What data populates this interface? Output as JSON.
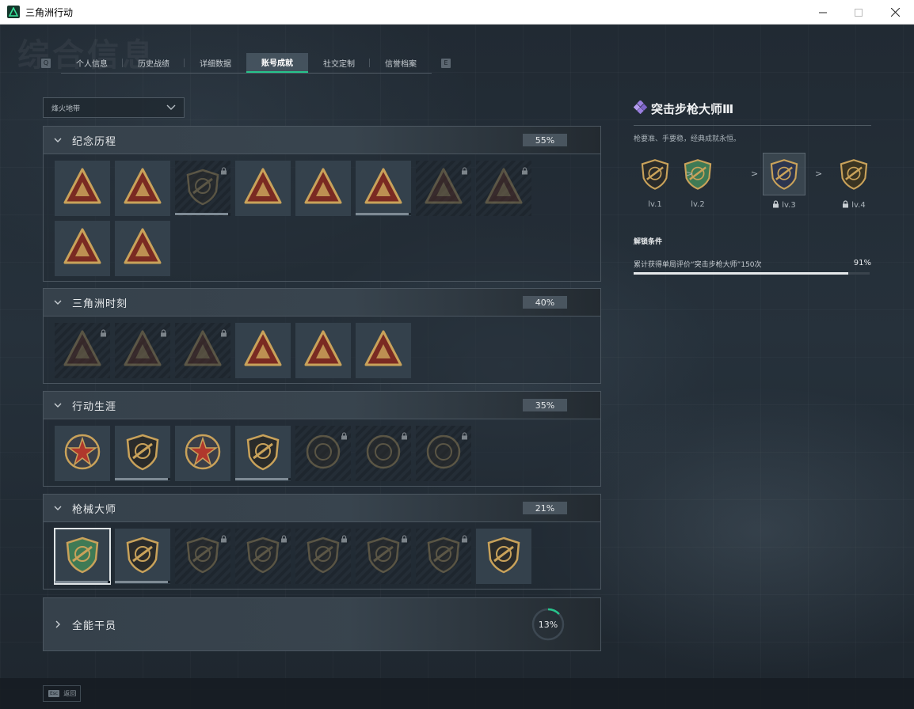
{
  "window": {
    "title": "三角洲行动",
    "minimize_icon": "minimize-icon",
    "maximize_icon": "maximize-icon",
    "close_icon": "close-icon"
  },
  "header": {
    "watermark": "综合信息"
  },
  "tabnav": {
    "left_key": "Q",
    "right_key": "E",
    "tabs": [
      {
        "label": "个人信息",
        "active": false
      },
      {
        "label": "历史战绩",
        "active": false
      },
      {
        "label": "详细数据",
        "active": false
      },
      {
        "label": "账号成就",
        "active": true
      },
      {
        "label": "社交定制",
        "active": false
      },
      {
        "label": "信誉档案",
        "active": false
      }
    ]
  },
  "filter": {
    "selected": "烽火地带"
  },
  "sections": [
    {
      "title": "纪念历程",
      "percent": "55%",
      "badges": [
        {
          "name": "pyramid-badge-icon",
          "locked": false,
          "progress": null
        },
        {
          "name": "helicopter-badge-icon",
          "locked": false,
          "progress": null
        },
        {
          "name": "cyber-shield-badge-icon",
          "locked": true,
          "progress": 0.95
        },
        {
          "name": "number-56-badge-icon",
          "locked": false,
          "progress": null
        },
        {
          "name": "canister-badge-icon",
          "locked": false,
          "progress": null
        },
        {
          "name": "number-58-badge-icon",
          "locked": false,
          "progress": 0.95
        },
        {
          "name": "soldier-badge-icon",
          "locked": true,
          "progress": null
        },
        {
          "name": "crossed-weapons-badge-icon",
          "locked": true,
          "progress": null
        },
        {
          "name": "helmet-badge-icon",
          "locked": false,
          "progress": null
        },
        {
          "name": "number-1-badge-icon",
          "locked": false,
          "progress": null
        }
      ]
    },
    {
      "title": "三角洲时刻",
      "percent": "40%",
      "badges": [
        {
          "name": "operator-badge-icon",
          "locked": true,
          "progress": null
        },
        {
          "name": "cargo-badge-icon",
          "locked": true,
          "progress": null
        },
        {
          "name": "runner-badge-icon",
          "locked": true,
          "progress": null
        },
        {
          "name": "wreath-badge-icon",
          "locked": false,
          "progress": null
        },
        {
          "name": "squad-badge-icon",
          "locked": false,
          "progress": null
        },
        {
          "name": "rocket-badge-icon",
          "locked": false,
          "progress": null
        }
      ]
    },
    {
      "title": "行动生涯",
      "percent": "35%",
      "badges": [
        {
          "name": "star-medal-badge-icon",
          "locked": false,
          "progress": null
        },
        {
          "name": "chevron-shield-badge-icon",
          "locked": false,
          "progress": 0.95
        },
        {
          "name": "stars-shield-badge-icon",
          "locked": false,
          "progress": null
        },
        {
          "name": "gem-shield-badge-icon",
          "locked": false,
          "progress": 0.95
        },
        {
          "name": "helmet-round-badge-icon",
          "locked": true,
          "progress": null
        },
        {
          "name": "skull-round-badge-icon",
          "locked": true,
          "progress": null
        },
        {
          "name": "eye-round-badge-icon",
          "locked": true,
          "progress": null
        }
      ]
    },
    {
      "title": "枪械大师",
      "percent": "21%",
      "badges": [
        {
          "name": "assault-rifle-green-badge-icon",
          "locked": false,
          "selected": true,
          "progress": 0.95
        },
        {
          "name": "rifle-badge-icon",
          "locked": false,
          "progress": 0.95
        },
        {
          "name": "sniper-badge-icon",
          "locked": true,
          "progress": null
        },
        {
          "name": "smg-badge-icon",
          "locked": true,
          "progress": null
        },
        {
          "name": "shotgun-badge-icon",
          "locked": true,
          "progress": null
        },
        {
          "name": "marksman-badge-icon",
          "locked": true,
          "progress": null
        },
        {
          "name": "pistol-badge-icon",
          "locked": true,
          "progress": null
        },
        {
          "name": "gold-crossed-rifles-badge-icon",
          "locked": false,
          "progress": null
        }
      ]
    }
  ],
  "collapsed_section": {
    "title": "全能干员",
    "percent": "13%",
    "fraction": 0.13
  },
  "detail": {
    "title": "突击步枪大师Ⅲ",
    "description": "枪要准、手要稳，经典成就永恒。",
    "levels": [
      {
        "label": "lv.1",
        "locked": false,
        "current": false
      },
      {
        "label": "lv.2",
        "locked": false,
        "current": false
      },
      {
        "label": "lv.3",
        "locked": true,
        "current": true
      },
      {
        "label": "lv.4",
        "locked": true,
        "current": false
      }
    ],
    "arrow": ">",
    "unlock_heading": "解锁条件",
    "condition": "累计获得单局评价“突击步枪大师”150次",
    "condition_percent": "91%",
    "condition_fraction": 0.91
  },
  "bottombar": {
    "esc_key": "Esc",
    "back_label": "返回"
  },
  "colors": {
    "accent_green": "#27c48c",
    "badge_gold": "#c9a25a",
    "badge_red": "#7a2a22",
    "detail_icon_purple": "#9a7fe0"
  }
}
